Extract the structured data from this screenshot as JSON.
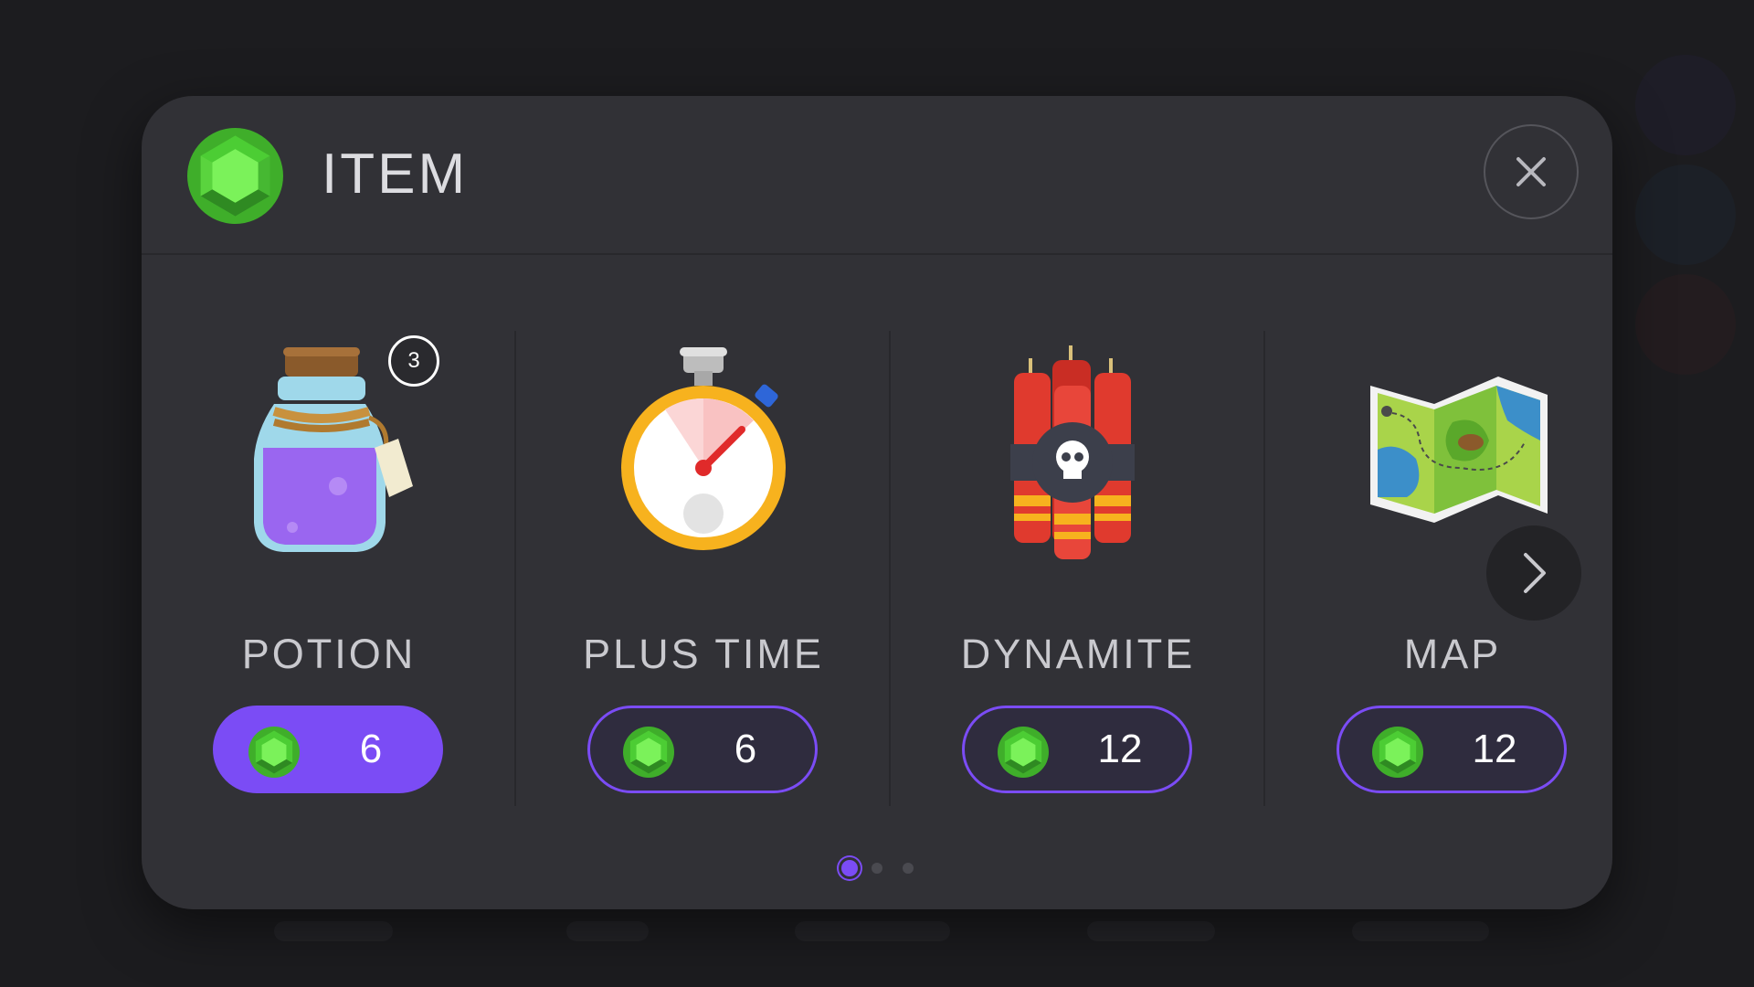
{
  "modal": {
    "title": "ITEM",
    "header_icon": "green-gem-icon",
    "close_icon": "close-icon"
  },
  "items": [
    {
      "name": "POTION",
      "icon": "potion-icon",
      "price": "6",
      "currency_icon": "green-gem-icon",
      "owned_count": "3",
      "selected": true
    },
    {
      "name": "PLUS TIME",
      "icon": "stopwatch-icon",
      "price": "6",
      "currency_icon": "green-gem-icon",
      "selected": false
    },
    {
      "name": "DYNAMITE",
      "icon": "dynamite-icon",
      "price": "12",
      "currency_icon": "green-gem-icon",
      "selected": false
    },
    {
      "name": "MAP",
      "icon": "treasure-map-icon",
      "price": "12",
      "currency_icon": "green-gem-icon",
      "selected": false
    }
  ],
  "navigation": {
    "next_icon": "chevron-right-icon"
  },
  "pager": {
    "pages": 3,
    "current_page": 1
  },
  "colors": {
    "accent": "#7b4cf5",
    "panel": "#313136",
    "gem": "#6fe14a"
  }
}
